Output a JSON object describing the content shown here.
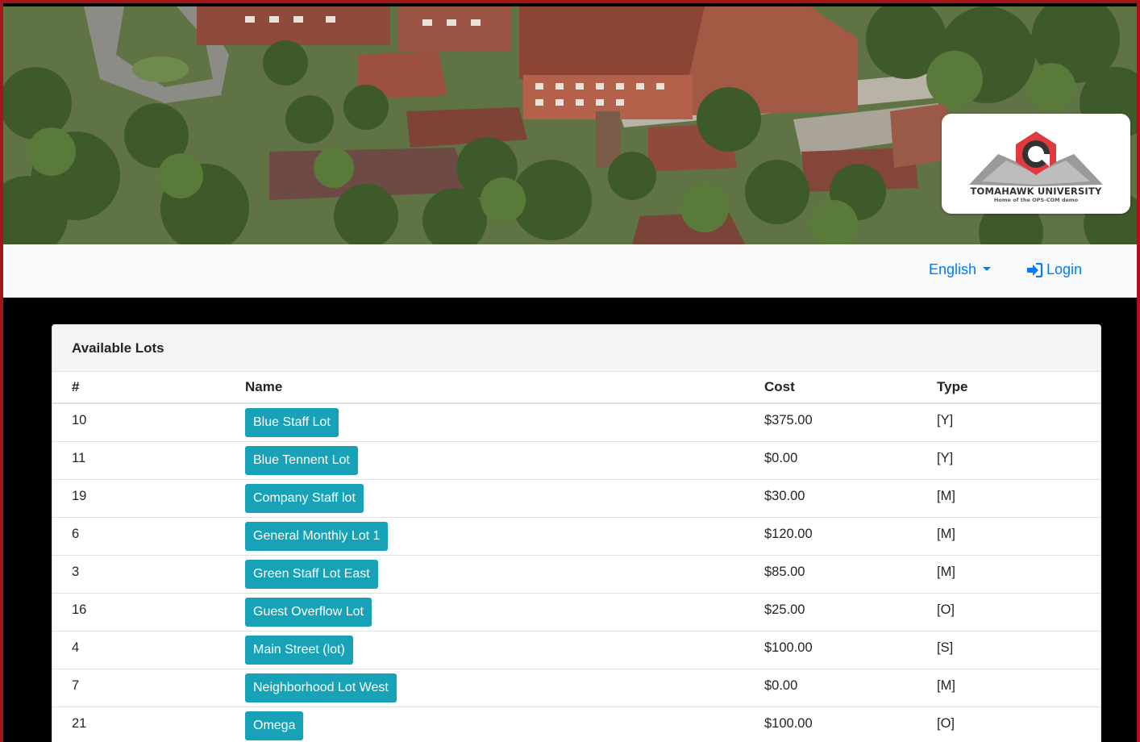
{
  "banner": {
    "logo": {
      "name": "TOMAHAWK UNIVERSITY",
      "tagline": "Home of the OPS-COM demo",
      "colors": {
        "ring": "#e03a3e",
        "dark": "#333333",
        "book": "#9a9a9a"
      }
    }
  },
  "nav": {
    "language_label": "English",
    "login_label": "Login",
    "link_color": "#007bff"
  },
  "lots": {
    "title": "Available Lots",
    "columns": [
      "#",
      "Name",
      "Cost",
      "Type"
    ],
    "button_color": "#17a2b8",
    "rows": [
      {
        "num": "10",
        "name": "Blue Staff Lot",
        "cost": "$375.00",
        "type": "[Y]"
      },
      {
        "num": "11",
        "name": "Blue Tennent Lot",
        "cost": "$0.00",
        "type": "[Y]"
      },
      {
        "num": "19",
        "name": "Company Staff lot",
        "cost": "$30.00",
        "type": "[M]"
      },
      {
        "num": "6",
        "name": "General Monthly Lot 1",
        "cost": "$120.00",
        "type": "[M]"
      },
      {
        "num": "3",
        "name": "Green Staff Lot East",
        "cost": "$85.00",
        "type": "[M]"
      },
      {
        "num": "16",
        "name": "Guest Overflow Lot",
        "cost": "$25.00",
        "type": "[O]"
      },
      {
        "num": "4",
        "name": "Main Street (lot)",
        "cost": "$100.00",
        "type": "[S]"
      },
      {
        "num": "7",
        "name": "Neighborhood Lot West",
        "cost": "$0.00",
        "type": "[M]"
      },
      {
        "num": "21",
        "name": "Omega",
        "cost": "$100.00",
        "type": "[O]"
      }
    ]
  }
}
